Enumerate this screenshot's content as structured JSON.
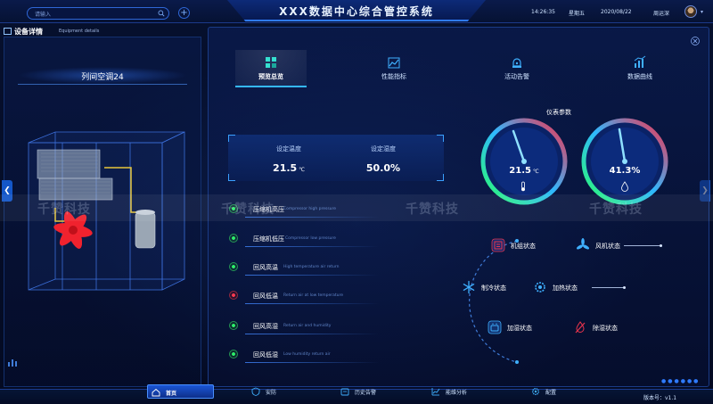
{
  "header": {
    "title": "XXX数据中心综合管控系统",
    "search_placeholder": "请输入",
    "time": "14:26:35",
    "weekday": "星期五",
    "date": "2020/08/22",
    "user": "周运深"
  },
  "left_panel": {
    "title": "设备详情",
    "subtitle": "Equipment details",
    "device_name": "列间空调24"
  },
  "tabs": [
    {
      "label": "预览总览",
      "icon": "grid-icon",
      "active": true
    },
    {
      "label": "性能指标",
      "icon": "performance-icon",
      "active": false
    },
    {
      "label": "活动告警",
      "icon": "alarm-icon",
      "active": false
    },
    {
      "label": "数据曲线",
      "icon": "bar-chart-icon",
      "active": false
    }
  ],
  "settings": {
    "temp_label": "设定温度",
    "temp_value": "21.5",
    "temp_unit": "℃",
    "humidity_label": "设定湿度",
    "humidity_value": "50.0%"
  },
  "indicators": [
    {
      "cn": "压缩机高压",
      "en": "Compressor high pressure",
      "status": "green"
    },
    {
      "cn": "压缩机低压",
      "en": "Compressor low pressure",
      "status": "green"
    },
    {
      "cn": "回风高温",
      "en": "High temperature air return",
      "status": "green"
    },
    {
      "cn": "回风低温",
      "en": "Return air at low temperature",
      "status": "red"
    },
    {
      "cn": "回风高湿",
      "en": "Return air and humidity",
      "status": "green"
    },
    {
      "cn": "回风低湿",
      "en": "Low humidity return air",
      "status": "green"
    }
  ],
  "gauges": {
    "title": "仪表参数",
    "temperature": {
      "value": "21.5",
      "unit": "℃",
      "icon": "thermometer-icon"
    },
    "humidity": {
      "value": "41.3%",
      "icon": "humidity-drop-icon"
    }
  },
  "statuses": [
    {
      "label": "机组状态",
      "icon": "unit-status-icon",
      "color": "#e8344c"
    },
    {
      "label": "风机状态",
      "icon": "fan-icon",
      "color": "#3fb0ff"
    },
    {
      "label": "制冷状态",
      "icon": "snowflake-icon",
      "color": "#3fb0ff"
    },
    {
      "label": "加热状态",
      "icon": "heating-gear-icon",
      "color": "#3fb0ff"
    },
    {
      "label": "加湿状态",
      "icon": "humidifier-icon",
      "color": "#3fb0ff"
    },
    {
      "label": "除湿状态",
      "icon": "dehumidify-icon",
      "color": "#e8344c"
    }
  ],
  "watermark": "千赞科技",
  "bottom_nav": [
    {
      "label": "首页",
      "icon": "home-icon",
      "active": true
    },
    {
      "label": "安防",
      "icon": "shield-icon",
      "active": false
    },
    {
      "label": "历史告警",
      "icon": "history-alarm-icon",
      "active": false
    },
    {
      "label": "能维分析",
      "icon": "analysis-icon",
      "active": false
    },
    {
      "label": "配置",
      "icon": "settings-gear-icon",
      "active": false
    }
  ],
  "version": "版本号：v1.1"
}
